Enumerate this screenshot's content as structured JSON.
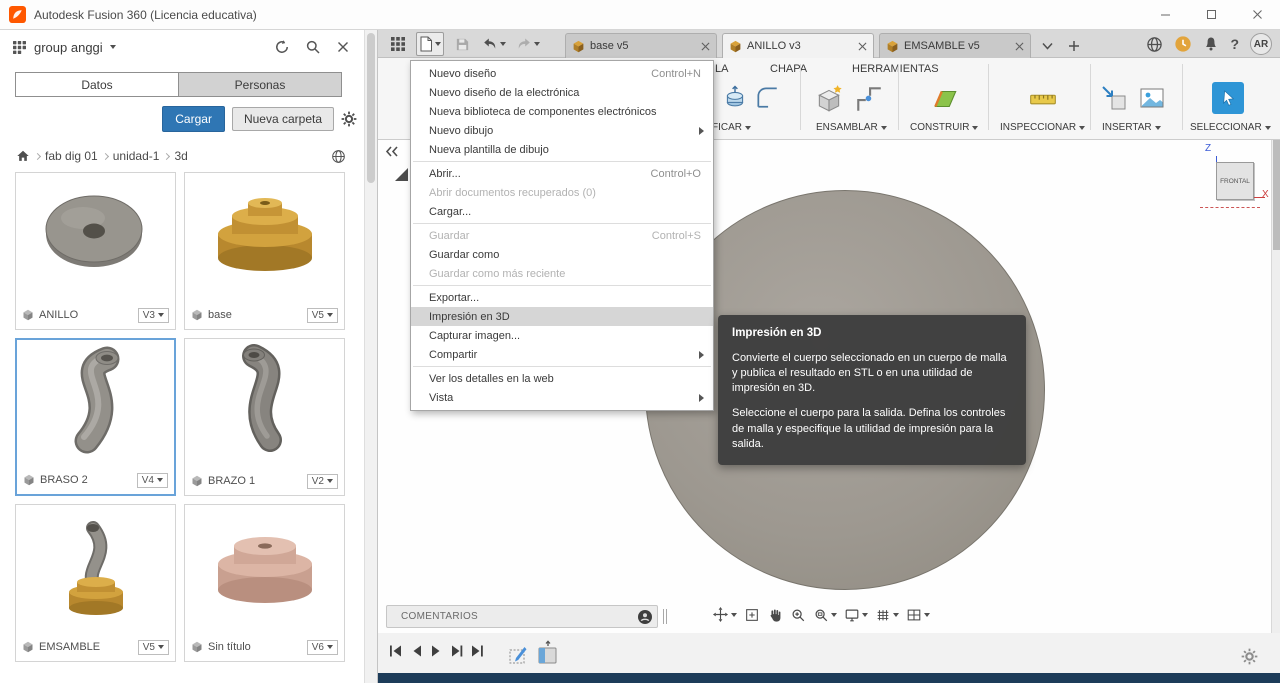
{
  "titlebar": {
    "title": "Autodesk Fusion 360 (Licencia educativa)"
  },
  "user": {
    "initials": "AR"
  },
  "icons": {
    "help": "?"
  },
  "panel": {
    "team": "group anggi",
    "tabs": {
      "datos": "Datos",
      "personas": "Personas"
    },
    "upload": "Cargar",
    "new_folder": "Nueva carpeta",
    "breadcrumb": [
      "fab dig 01",
      "unidad-1",
      "3d"
    ],
    "cards": [
      {
        "name": "ANILLO",
        "version": "V3"
      },
      {
        "name": "base",
        "version": "V5"
      },
      {
        "name": "BRASO 2",
        "version": "V4"
      },
      {
        "name": "BRAZO 1",
        "version": "V2"
      },
      {
        "name": "EMSAMBLE",
        "version": "V5"
      },
      {
        "name": "Sin título",
        "version": "V6"
      }
    ]
  },
  "doc_tabs": [
    {
      "label": "base v5"
    },
    {
      "label": "ANILLO v3"
    },
    {
      "label": "EMSAMBLE v5"
    }
  ],
  "ribbon": {
    "tabs": [
      "LA",
      "CHAPA",
      "HERRAMIENTAS"
    ],
    "groups": [
      "DIFICAR",
      "ENSAMBLAR",
      "CONSTRUIR",
      "INSPECCIONAR",
      "INSERTAR",
      "SELECCIONAR"
    ]
  },
  "file_menu": {
    "items": [
      {
        "label": "Nuevo diseño",
        "shortcut": "Control+N"
      },
      {
        "label": "Nuevo diseño de la electrónica"
      },
      {
        "label": "Nueva biblioteca de componentes electrónicos"
      },
      {
        "label": "Nuevo dibujo"
      },
      {
        "label": "Nueva plantilla de dibujo"
      },
      {
        "label": "Abrir...",
        "shortcut": "Control+O"
      },
      {
        "label": "Abrir documentos recuperados (0)"
      },
      {
        "label": "Cargar..."
      },
      {
        "label": "Guardar",
        "shortcut": "Control+S"
      },
      {
        "label": "Guardar como"
      },
      {
        "label": "Guardar como más reciente"
      },
      {
        "label": "Exportar..."
      },
      {
        "label": "Impresión en 3D"
      },
      {
        "label": "Capturar imagen..."
      },
      {
        "label": "Compartir"
      },
      {
        "label": "Ver los detalles en la web"
      },
      {
        "label": "Vista"
      }
    ]
  },
  "tooltip": {
    "title": "Impresión en 3D",
    "p1": "Convierte el cuerpo seleccionado en un cuerpo de malla y publica el resultado en STL o en una utilidad de impresión en 3D.",
    "p2": "Seleccione el cuerpo para la salida. Defina los controles de malla y especifique la utilidad de impresión para la salida."
  },
  "viewcube": {
    "face": "FRONTAL",
    "z": "Z",
    "x": "X"
  },
  "comments": {
    "label": "COMENTARIOS"
  },
  "colors": {
    "accent_blue": "#2f76b4",
    "selection_blue": "#2e95d6",
    "tooltip_bg": "#3e3e3e",
    "model_gray": "#9d9890",
    "gold": "#d2a23e",
    "status_bar": "#1d3c59"
  }
}
